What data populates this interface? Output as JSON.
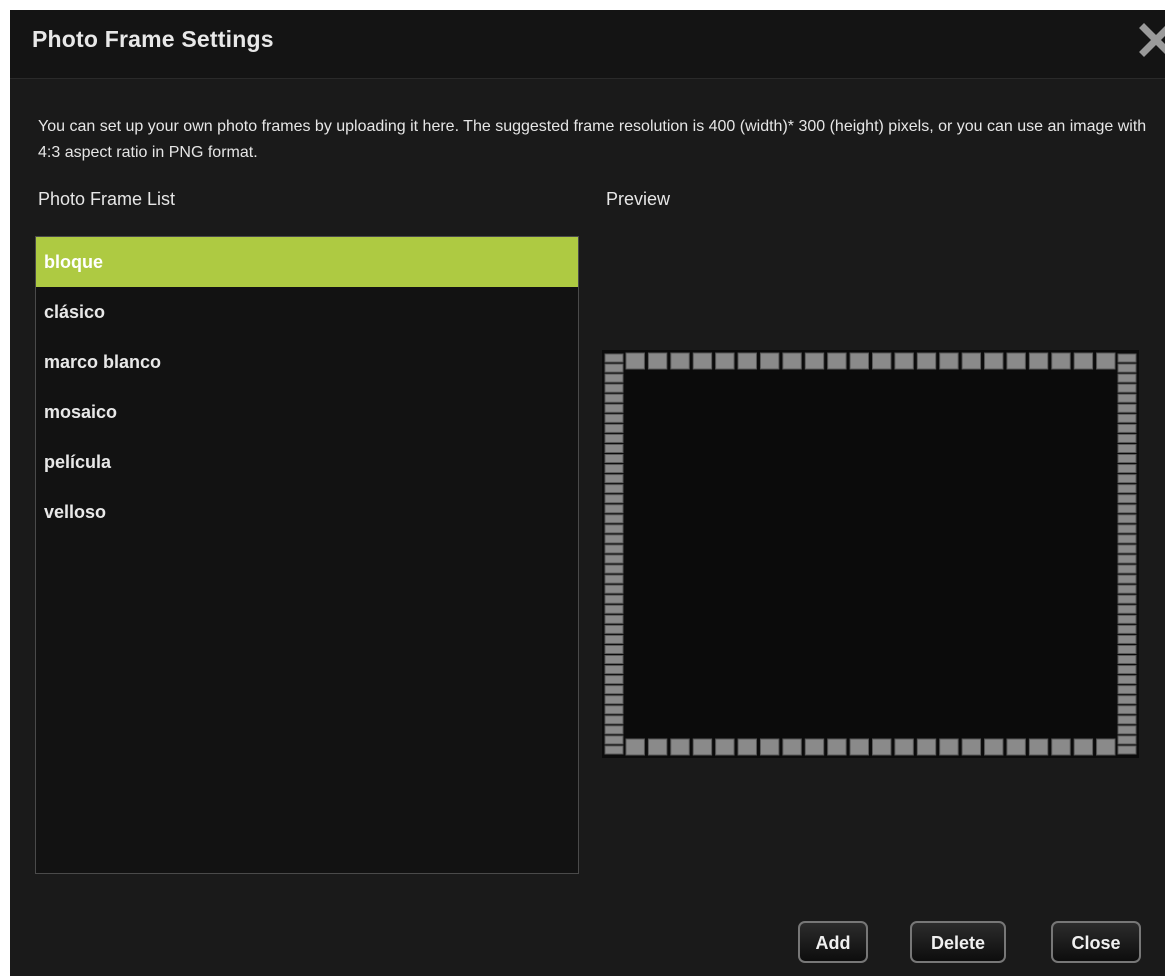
{
  "dialog": {
    "title": "Photo Frame Settings",
    "close_icon": "close-icon",
    "description": "You can set up your own photo frames by uploading it here. The suggested frame resolution is 400 (width)* 300 (height) pixels, or you can use an image with 4:3 aspect ratio in PNG format.",
    "list_label": "Photo Frame List",
    "preview_label": "Preview"
  },
  "frames": {
    "selected_index": 0,
    "items": [
      {
        "label": "bloque"
      },
      {
        "label": "clásico"
      },
      {
        "label": "marco blanco"
      },
      {
        "label": "mosaico"
      },
      {
        "label": "película"
      },
      {
        "label": "velloso"
      }
    ]
  },
  "buttons": {
    "add": "Add",
    "delete": "Delete",
    "close": "Close"
  },
  "colors": {
    "dialog_background": "#1a1a1a",
    "selection_accent": "#aeca42",
    "frame_block": "#8a8a8a"
  }
}
